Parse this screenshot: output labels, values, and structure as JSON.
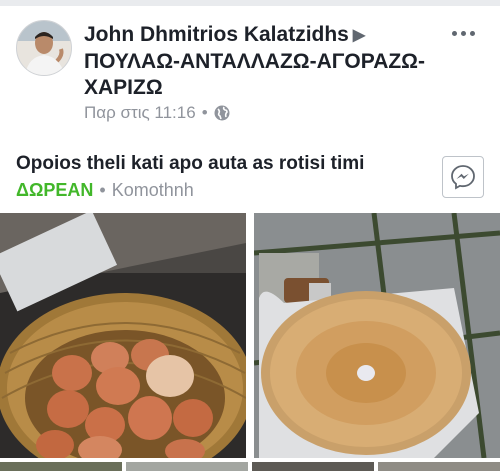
{
  "post": {
    "author": "John Dhmitrios Kalatzidhs",
    "group_name": "ΠΟΥΛΑΩ-ΑΝΤΑΛΛΑΖΩ-ΑΓΟΡΑΖΩ-ΧΑΡΙΖΩ",
    "timestamp": "Παρ στις 11:16",
    "separator": "•",
    "text": "Opoios theli kati apo auta as rotisi timi",
    "price": "ΔΩΡΕΑΝ",
    "location": "Komothnh"
  },
  "icons": {
    "author_arrow": "play-triangle-icon",
    "audience": "globe-icon",
    "menu": "more-dots-icon",
    "messenger": "messenger-icon"
  },
  "colors": {
    "price_green": "#42b72a",
    "meta_gray": "#90949c",
    "text_dark": "#1d2129"
  }
}
